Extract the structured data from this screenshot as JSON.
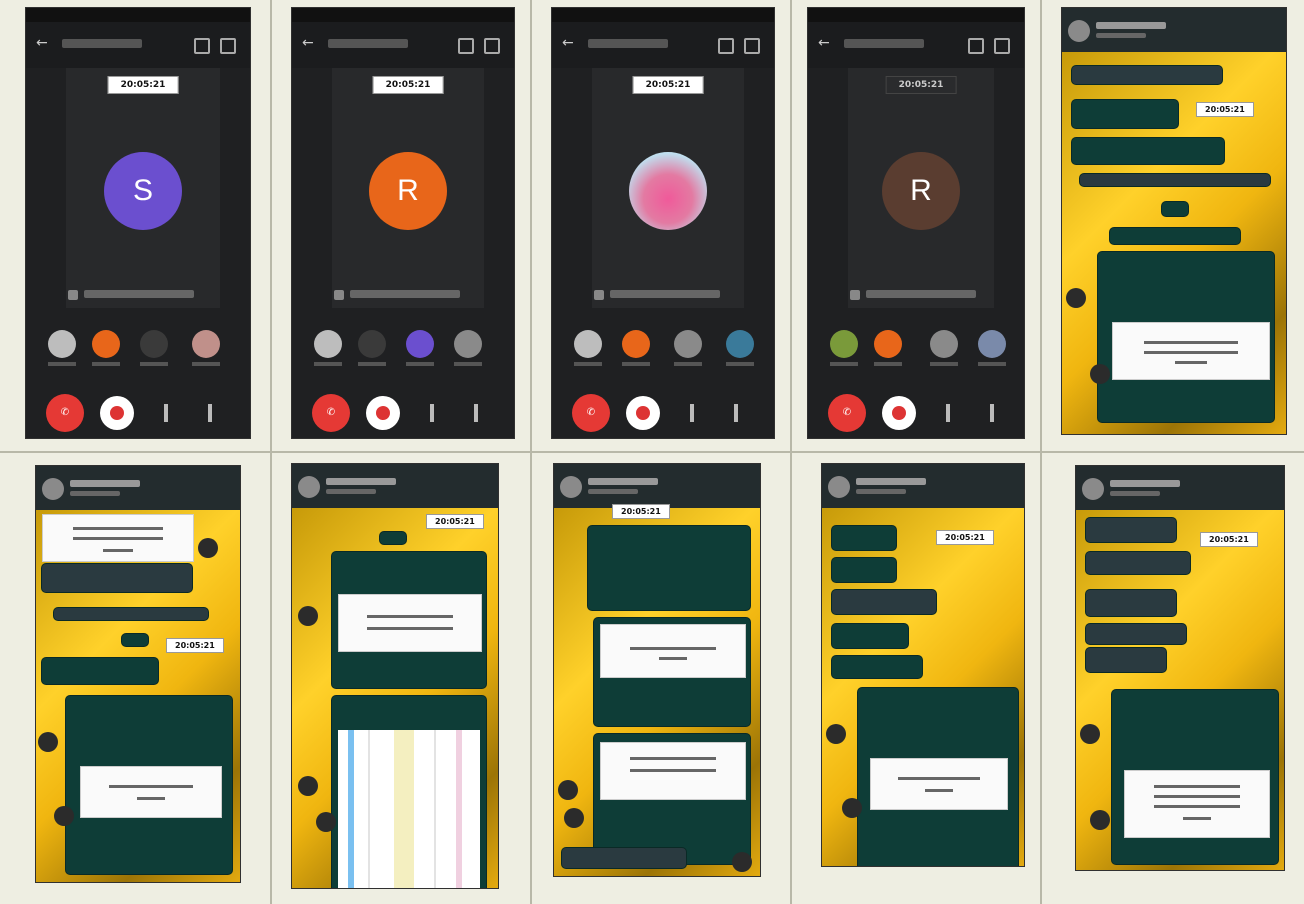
{
  "panels": [
    {
      "type": "call",
      "timestamp": "20:05:21",
      "avatar_letter": "S",
      "avatar_color": "#6b4fcf"
    },
    {
      "type": "call",
      "timestamp": "20:05:21",
      "avatar_letter": "R",
      "avatar_color": "#e8661a"
    },
    {
      "type": "call",
      "timestamp": "20:05:21",
      "avatar_letter": "",
      "avatar_color": "#e37aa2"
    },
    {
      "type": "call",
      "timestamp": "20:05:21",
      "avatar_letter": "R",
      "avatar_color": "#5a3d30"
    },
    {
      "type": "chat",
      "timestamp": "20:05:21"
    },
    {
      "type": "chat",
      "timestamp": "20:05:21"
    },
    {
      "type": "chat",
      "timestamp": "20:05:21"
    },
    {
      "type": "chat",
      "timestamp": "20:05:21"
    },
    {
      "type": "chat",
      "timestamp": "20:05:21"
    },
    {
      "type": "chat",
      "timestamp": "20:05:21"
    }
  ],
  "controls": {
    "end_call_icon": "phone-hangup-icon",
    "camera_icon": "camera-icon",
    "mic_icon": "mic-icon"
  },
  "colors": {
    "chat_bubble": "#0e3d37",
    "wallpaper": "#ffd12a",
    "end_call": "#e53935"
  }
}
